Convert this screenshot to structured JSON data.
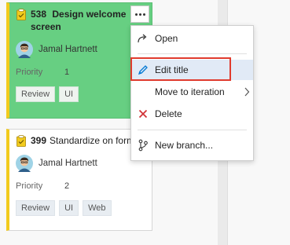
{
  "cards": [
    {
      "id": "538",
      "title": "Design welcome screen",
      "assignee": "Jamal Hartnett",
      "field_label": "Priority",
      "field_value": "1",
      "tags": [
        "Review",
        "UI"
      ]
    },
    {
      "id": "399",
      "title": "Standardize on form",
      "assignee": "Jamal Hartnett",
      "field_label": "Priority",
      "field_value": "2",
      "tags": [
        "Review",
        "UI",
        "Web"
      ]
    }
  ],
  "menu": {
    "open": "Open",
    "edit_title": "Edit title",
    "move_to_iteration": "Move to iteration",
    "delete": "Delete",
    "new_branch": "New branch..."
  },
  "colors": {
    "selected_card": "#67cf82",
    "work_item_stripe": "#f2cb1d",
    "highlight": "#e03b2e",
    "delete_icon": "#d13438",
    "edit_icon": "#0078d4"
  }
}
